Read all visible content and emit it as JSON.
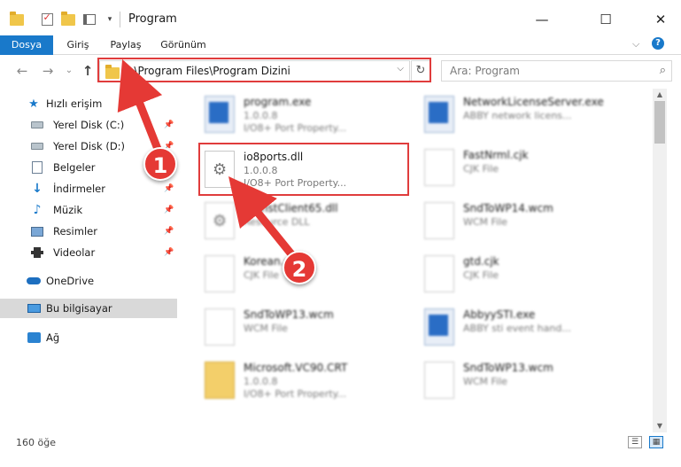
{
  "window": {
    "title": "Program",
    "minimize_glyph": "—",
    "maximize_glyph": "☐",
    "close_glyph": "✕"
  },
  "ribbon": {
    "tabs": [
      "Dosya",
      "Giriş",
      "Paylaş",
      "Görünüm"
    ],
    "expand_glyph": "⌵",
    "help_glyph": "?"
  },
  "navigation": {
    "back_glyph": "←",
    "forward_glyph": "→",
    "recent_glyph": "⌄",
    "up_glyph": "↑",
    "address": "C:\\Program Files\\Program Dizini",
    "address_dropdown_glyph": "⌵",
    "refresh_glyph": "↻",
    "search_placeholder": "Ara: Program",
    "search_glyph": "⌕"
  },
  "sidebar": {
    "quick_access": "Hızlı erişim",
    "items": [
      {
        "label": "Yerel Disk (C:)",
        "icon": "drive-icon"
      },
      {
        "label": "Yerel Disk (D:)",
        "icon": "drive-icon"
      },
      {
        "label": "Belgeler",
        "icon": "documents-icon"
      },
      {
        "label": "İndirmeler",
        "icon": "downloads-icon"
      },
      {
        "label": "Müzik",
        "icon": "music-icon"
      },
      {
        "label": "Resimler",
        "icon": "pictures-icon"
      },
      {
        "label": "Videolar",
        "icon": "videos-icon"
      }
    ],
    "onedrive": "OneDrive",
    "this_pc": "Bu bilgisayar",
    "network": "Ağ",
    "pin_glyph": "📌"
  },
  "files": {
    "left": [
      {
        "name": "program.exe",
        "line2": "1.0.0.8",
        "line3": "I/O8+ Port Property..."
      },
      {
        "name": "io8ports.dll",
        "line2": "1.0.0.8",
        "line3": "I/O8+ Port Property..."
      },
      {
        "name": "UnInstClient65.dll",
        "line2": "Resource DLL",
        "line3": ""
      },
      {
        "name": "Korean.cjk",
        "line2": "CJK File",
        "line3": ""
      },
      {
        "name": "SndToWP13.wcm",
        "line2": "WCM File",
        "line3": ""
      },
      {
        "name": "Microsoft.VC90.CRT",
        "line2": "1.0.0.8",
        "line3": "I/O8+ Port Property..."
      }
    ],
    "right": [
      {
        "name": "NetworkLicenseServer.exe",
        "line2": "ABBY network licens...",
        "line3": ""
      },
      {
        "name": "FastNrml.cjk",
        "line2": "CJK File",
        "line3": ""
      },
      {
        "name": "SndToWP14.wcm",
        "line2": "WCM File",
        "line3": ""
      },
      {
        "name": "gtd.cjk",
        "line2": "CJK File",
        "line3": ""
      },
      {
        "name": "AbbyySTI.exe",
        "line2": "ABBY sti event hand...",
        "line3": ""
      },
      {
        "name": "SndToWP13.wcm",
        "line2": "WCM File",
        "line3": ""
      }
    ]
  },
  "status": {
    "item_count": "160 öğe"
  },
  "annotations": {
    "step1": "1",
    "step2": "2",
    "color": "#e53935"
  }
}
